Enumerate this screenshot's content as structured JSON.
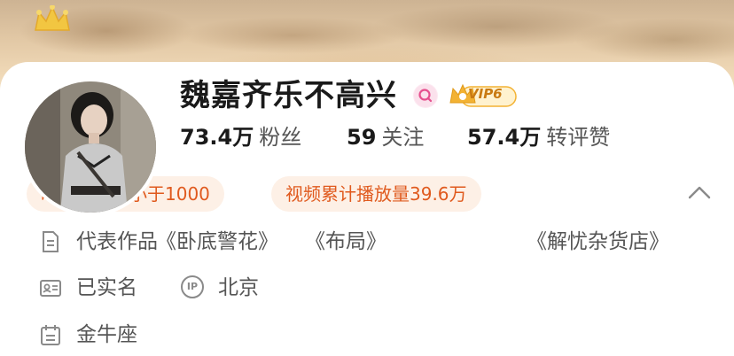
{
  "profile": {
    "name": "魏嘉齐乐不高兴",
    "vip_label": "VIP6"
  },
  "stats": [
    {
      "value": "73.4万",
      "label": "粉丝"
    },
    {
      "value": "59",
      "label": "关注"
    },
    {
      "value": "57.4万",
      "label": "转评赞"
    }
  ],
  "highlights": [
    "昨日阅读数小于1000",
    "视频累计播放量39.6万"
  ],
  "info": {
    "works_label": "代表作品",
    "works": [
      "《卧底警花》",
      "《布局》",
      "《解忧杂货店》"
    ],
    "verified": "已实名",
    "ip_badge": "IP",
    "location": "北京",
    "zodiac": "金牛座"
  },
  "colors": {
    "accent_orange": "#e05a1e",
    "pill_bg": "#fdf0e6",
    "vip_gold": "#f3b233",
    "verify_pink": "#e6508e"
  }
}
